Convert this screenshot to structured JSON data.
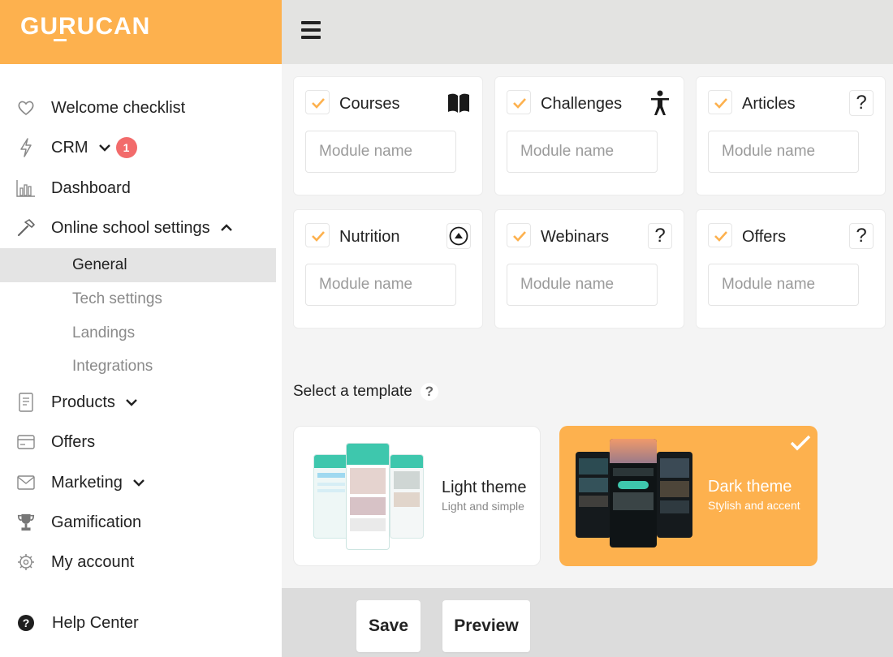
{
  "brand": {
    "logo_text": "GURUCAN",
    "accent_color": "#fdb14e"
  },
  "sidebar": {
    "items": [
      {
        "label": "Welcome checklist",
        "icon": "heart-icon"
      },
      {
        "label": "CRM",
        "icon": "bolt-icon",
        "badge": "1"
      },
      {
        "label": "Dashboard",
        "icon": "bar-chart-icon"
      },
      {
        "label": "Online school settings",
        "icon": "hammer-icon",
        "children": [
          "General",
          "Tech settings",
          "Landings",
          "Integrations"
        ],
        "active_child": "General"
      },
      {
        "label": "Products",
        "icon": "document-icon"
      },
      {
        "label": "Offers",
        "icon": "card-icon"
      },
      {
        "label": "Marketing",
        "icon": "envelope-icon"
      },
      {
        "label": "Gamification",
        "icon": "trophy-icon"
      },
      {
        "label": "My account",
        "icon": "gear-icon"
      }
    ],
    "help": {
      "label": "Help Center",
      "icon": "help-circle-icon"
    }
  },
  "modules": [
    {
      "title": "Courses",
      "checked": true,
      "icon": "book-icon",
      "placeholder": "Module name"
    },
    {
      "title": "Challenges",
      "checked": true,
      "icon": "person-icon",
      "placeholder": "Module name"
    },
    {
      "title": "Articles",
      "checked": true,
      "icon": "question-icon",
      "placeholder": "Module name"
    },
    {
      "title": "Nutrition",
      "checked": true,
      "icon": "up-arrow-circle-icon",
      "placeholder": "Module name"
    },
    {
      "title": "Webinars",
      "checked": true,
      "icon": "question-icon",
      "placeholder": "Module name"
    },
    {
      "title": "Offers",
      "checked": true,
      "icon": "question-icon",
      "placeholder": "Module name"
    }
  ],
  "template_section": {
    "heading": "Select a template",
    "help_glyph": "?",
    "templates": [
      {
        "name": "Light theme",
        "subtitle": "Light and simple",
        "selected": false
      },
      {
        "name": "Dark theme",
        "subtitle": "Stylish and accent",
        "selected": true
      }
    ]
  },
  "footer": {
    "save_label": "Save",
    "preview_label": "Preview"
  },
  "icon_glyphs": {
    "question": "?"
  }
}
